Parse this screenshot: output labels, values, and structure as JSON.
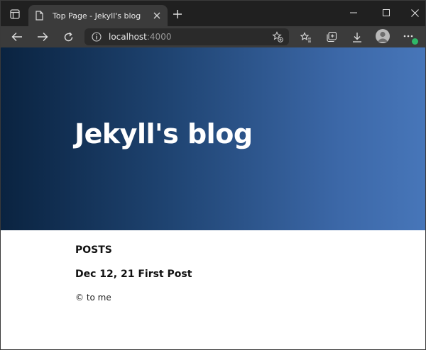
{
  "browser": {
    "tab": {
      "title": "Top Page - Jekyll's blog"
    },
    "address": {
      "host": "localhost",
      "port": ":4000"
    }
  },
  "page": {
    "site_title": "Jekyll's blog",
    "posts_heading": "POSTS",
    "posts": [
      {
        "date": "Dec 12, 21",
        "title": "First Post"
      }
    ],
    "footer": "© to me"
  },
  "colors": {
    "chrome_dark": "#202020",
    "toolbar": "#3b3b3b",
    "hero_start": "#0a2340",
    "hero_end": "#4776b9",
    "badge_green": "#2fb868"
  },
  "icons": {
    "tab_actions": "tab-actions-icon",
    "favicon": "document-icon",
    "close": "close-icon",
    "new_tab": "plus-icon",
    "minimize": "minimize-icon",
    "maximize": "maximize-icon",
    "window_close": "close-window-icon",
    "back": "back-arrow-icon",
    "forward": "forward-arrow-icon",
    "refresh": "refresh-icon",
    "info": "info-icon",
    "add_favorite": "star-plus-icon",
    "favorites": "favorites-icon",
    "collections": "collections-icon",
    "downloads": "download-icon",
    "profile": "profile-avatar-icon",
    "more": "more-icon"
  }
}
